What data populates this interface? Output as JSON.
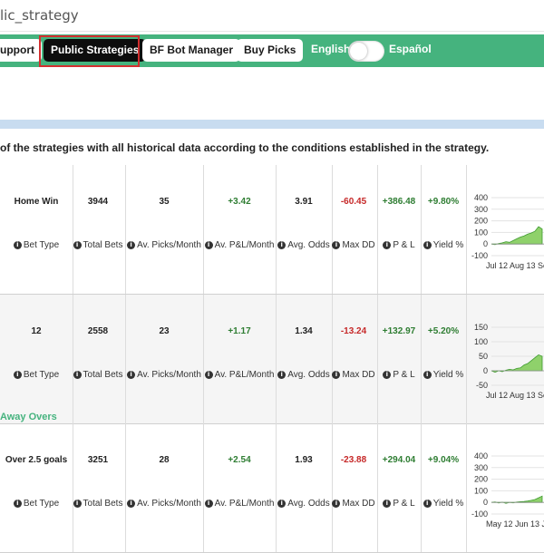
{
  "browser": {
    "url_text": "lic_strategy"
  },
  "nav": {
    "buttons": [
      {
        "label": "upport"
      },
      {
        "label": "Public Strategies"
      },
      {
        "label": "BF Bot Manager"
      },
      {
        "label": "Buy Picks"
      }
    ],
    "lang_left": "English",
    "lang_right": "Español"
  },
  "description": "of the strategies with all historical data according to the conditions established in the strategy.",
  "labels": {
    "bet_type": "Bet Type",
    "total_bets": "Total Bets",
    "picks_month": "Av. Picks/Month",
    "pl_month": "Av. P&L/Month",
    "avg_odds": "Avg. Odds",
    "max_dd": "Max DD",
    "pl": "P & L",
    "yield": "Yield %"
  },
  "info_glyph": "i",
  "strategies": [
    {
      "name": "",
      "bet_type": "Home Win",
      "total_bets": "3944",
      "picks_month": "35",
      "pl_month": "+3.42",
      "avg_odds": "3.91",
      "max_dd": "-60.45",
      "pl": "+386.48",
      "yield": "+9.80%",
      "chart": {
        "yticks": [
          "400",
          "300",
          "200",
          "100",
          "0",
          "-100"
        ],
        "xtick_text": "Jul 12  Aug 13 Se",
        "ymin": -100,
        "ymax": 400
      }
    },
    {
      "name": "",
      "bet_type": "12",
      "total_bets": "2558",
      "picks_month": "23",
      "pl_month": "+1.17",
      "avg_odds": "1.34",
      "max_dd": "-13.24",
      "pl": "+132.97",
      "yield": "+5.20%",
      "chart": {
        "yticks": [
          "150",
          "100",
          "50",
          "0",
          "-50"
        ],
        "xtick_text": "Jul 12  Aug 13 Se",
        "ymin": -50,
        "ymax": 150
      }
    },
    {
      "name": "Away Overs",
      "bet_type": "Over 2.5 goals",
      "total_bets": "3251",
      "picks_month": "28",
      "pl_month": "+2.54",
      "avg_odds": "1.93",
      "max_dd": "-23.88",
      "pl": "+294.04",
      "yield": "+9.04%",
      "chart": {
        "yticks": [
          "400",
          "300",
          "200",
          "100",
          "0",
          "-100"
        ],
        "xtick_text": "May 12 Jun 13  J",
        "ymin": -100,
        "ymax": 400
      }
    }
  ],
  "colors": {
    "brand": "#45b37e",
    "positive": "#2e7d32",
    "negative": "#c62828",
    "active_outline": "#d32f2f"
  }
}
